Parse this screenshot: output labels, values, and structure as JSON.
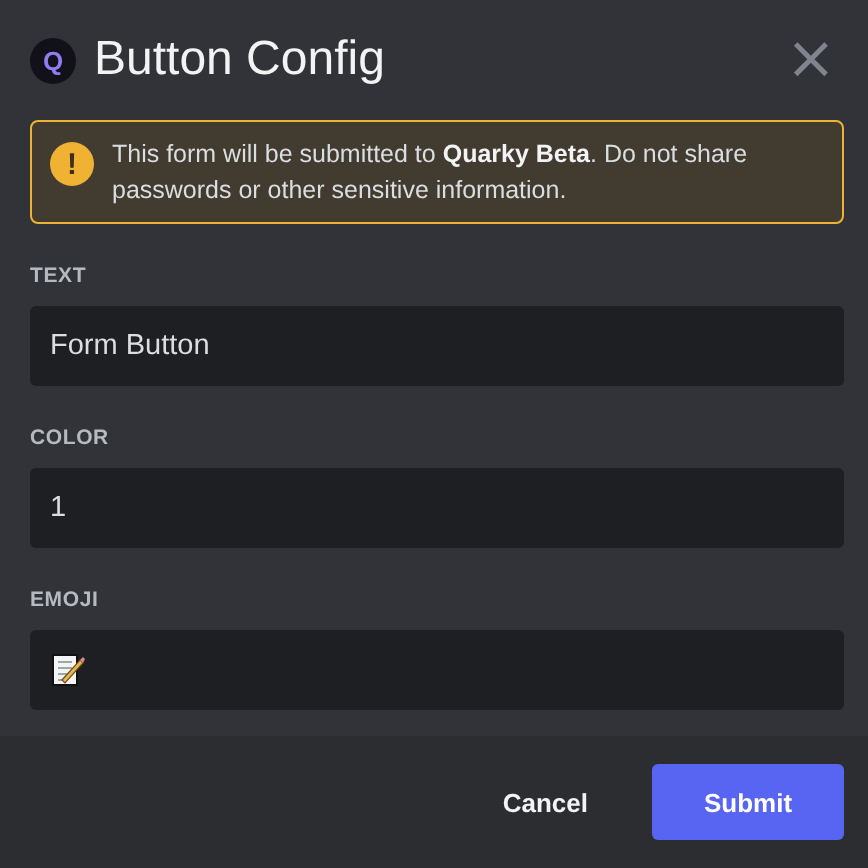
{
  "header": {
    "logo": "Q",
    "title": "Button Config",
    "close": "×"
  },
  "warning": {
    "icon": "!",
    "text": "This form will be submitted to **Quarky Beta**. Do not share passwords or other sensitive information."
  },
  "fields": [
    {
      "label": "TEXT",
      "kind": "text",
      "value": "Form Button"
    },
    {
      "label": "COLOR",
      "kind": "text",
      "value": "1"
    },
    {
      "label": "EMOJI",
      "kind": "emoji"
    }
  ],
  "buttons": [
    {
      "label": "Cancel",
      "kind": "link"
    },
    {
      "label": "Submit",
      "kind": "primary"
    }
  ]
}
